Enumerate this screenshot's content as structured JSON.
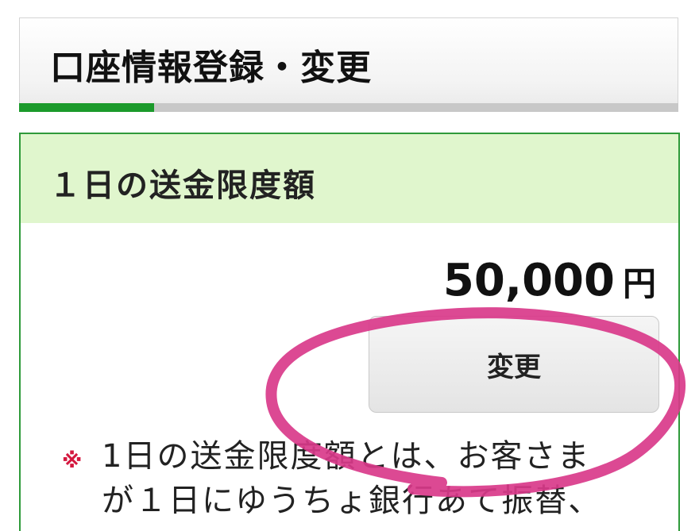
{
  "header": {
    "title": "口座情報登録・変更",
    "progress_fraction": 0.205
  },
  "limit_section": {
    "title": "１日の送金限度額",
    "amount": "50,000",
    "unit": "円",
    "change_button_label": "変更",
    "note_mark": "※",
    "note_lines": [
      "1日の送金限度額とは、お客さま",
      "が１日にゆうちょ銀行あて振替、"
    ]
  },
  "colors": {
    "accent_green": "#1b9a2b",
    "section_header_bg": "#e0f6cd",
    "note_mark_red": "#d4173e",
    "annotation_pink": "#d93a8a"
  }
}
